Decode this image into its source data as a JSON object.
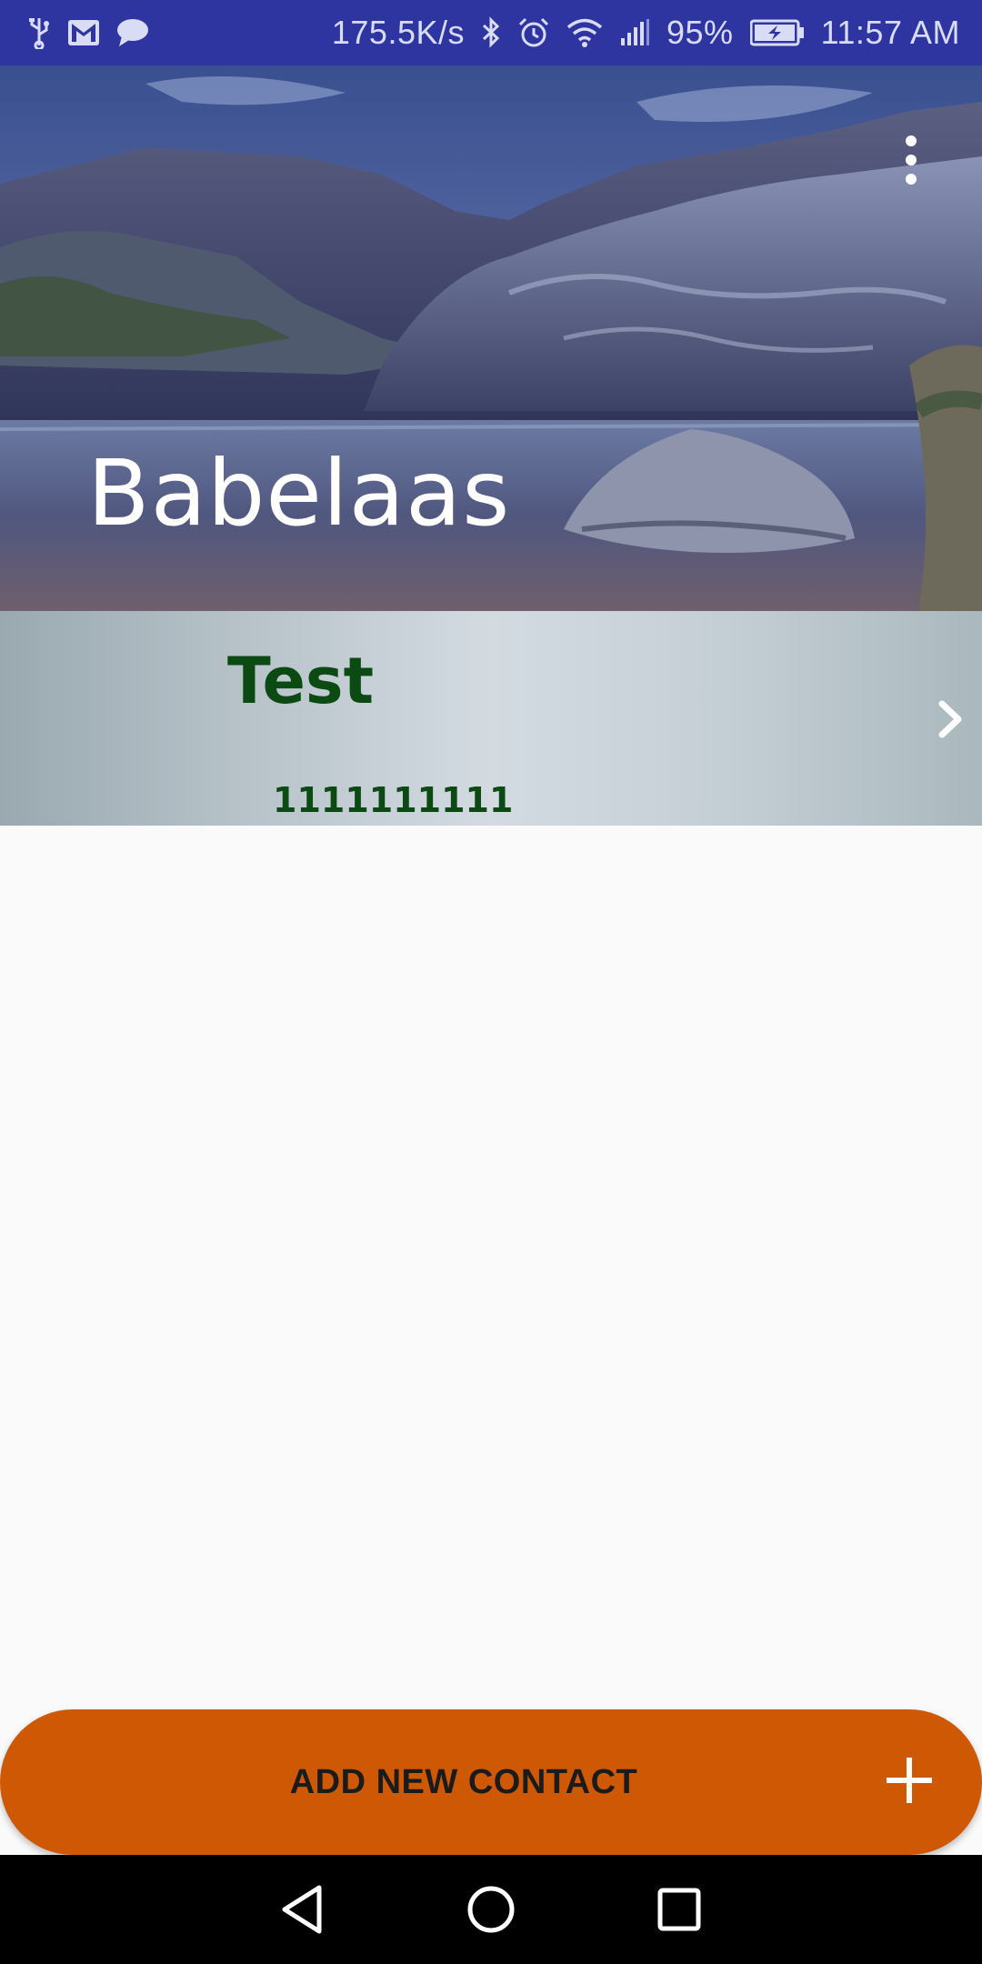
{
  "status_bar": {
    "network_speed": "175.5K/s",
    "battery_percent": "95%",
    "time": "11:57 AM",
    "left_icons": [
      "usb-icon",
      "gmail-icon",
      "chat-icon"
    ],
    "right_icons": [
      "bluetooth-icon",
      "alarm-icon",
      "wifi-icon",
      "signal-icon",
      "battery-charging-icon"
    ]
  },
  "header": {
    "title": "Babelaas",
    "menu_icon": "more-vert-icon"
  },
  "contacts": [
    {
      "name": "Test",
      "phone": "1111111111",
      "action_icon": "chevron-right-icon"
    }
  ],
  "fab": {
    "label": "ADD NEW CONTACT",
    "icon": "plus-icon",
    "color": "#cf5804"
  },
  "nav_bar": {
    "buttons": [
      "back-icon",
      "home-icon",
      "recents-icon"
    ]
  },
  "colors": {
    "status_bar": "#2e35a1",
    "contact_text": "#0b4a12",
    "fab": "#cf5804"
  }
}
